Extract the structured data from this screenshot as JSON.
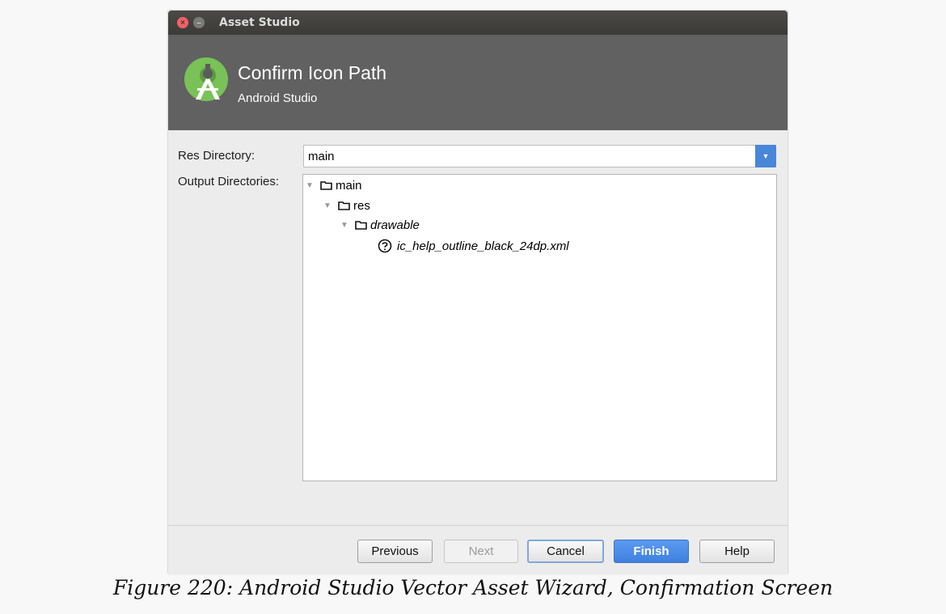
{
  "window": {
    "title": "Asset Studio",
    "close_glyph": "×",
    "min_glyph": "–"
  },
  "header": {
    "title": "Confirm Icon Path",
    "subtitle": "Android Studio",
    "logo_icon": "android-studio-logo"
  },
  "form": {
    "res_directory_label": "Res Directory:",
    "res_directory_value": "main",
    "output_directories_label": "Output Directories:"
  },
  "tree": [
    {
      "label": "main",
      "icon": "folder-icon",
      "expanded": true
    },
    {
      "label": "res",
      "icon": "folder-icon",
      "expanded": true
    },
    {
      "label": "drawable",
      "icon": "folder-icon",
      "expanded": true
    },
    {
      "label": "ic_help_outline_black_24dp.xml",
      "icon": "help-outline-icon"
    }
  ],
  "buttons": {
    "previous": "Previous",
    "next": "Next",
    "cancel": "Cancel",
    "finish": "Finish",
    "help": "Help"
  },
  "caption": "Figure 220: Android Studio Vector Asset Wizard, Confirmation Screen",
  "colors": {
    "header_bg": "#616161",
    "accent": "#4a86d8",
    "logo_green": "#78c257"
  }
}
